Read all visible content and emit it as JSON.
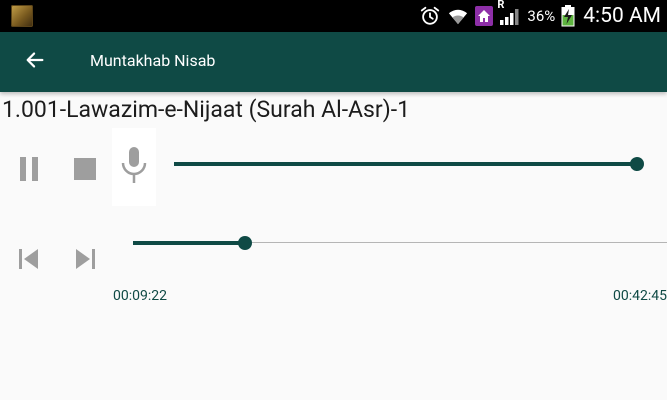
{
  "status_bar": {
    "battery_percent": "36%",
    "clock": "4:50 AM",
    "network_label": "R",
    "icons": [
      "app-thumbnail",
      "alarm-icon",
      "wifi-icon",
      "home-icon",
      "signal-icon",
      "battery-charging-icon"
    ]
  },
  "app_bar": {
    "title": "Muntakhab Nisab",
    "back_icon": "arrow-back-icon",
    "background_color": "#0f4a45"
  },
  "track": {
    "title": "1.001-Lawazim-e-Nijaat (Surah Al-Asr)-1"
  },
  "controls": {
    "pause_icon": "pause-icon",
    "stop_icon": "stop-icon",
    "mic_icon": "microphone-icon",
    "prev_icon": "skip-previous-icon",
    "next_icon": "skip-next-icon"
  },
  "volume": {
    "level": 1.0
  },
  "seek": {
    "elapsed": "00:09:22",
    "total": "00:42:45",
    "progress": 0.21
  },
  "colors": {
    "accent": "#0f4a45",
    "rail": "#b5b5b5",
    "icon_gray": "#9e9e9e"
  }
}
